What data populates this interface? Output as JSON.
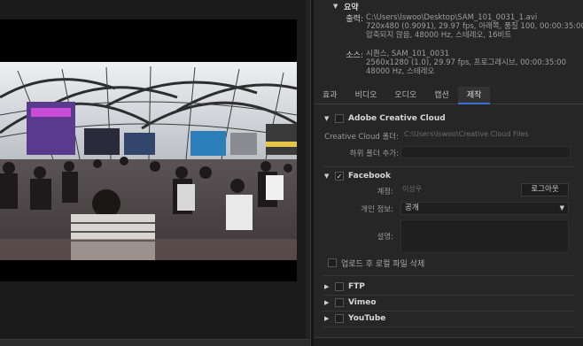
{
  "summary": {
    "title": "요약",
    "output_label": "출력:",
    "output_lines": [
      "C:\\Users\\lswoo\\Desktop\\SAM_101_0031_1.avi",
      "720x480 (0.9091), 29.97 fps, 아래쪽, 품질 100, 00:00:35:00",
      "압축되지 않음, 48000 Hz, 스테레오, 16비트"
    ],
    "source_label": "소스:",
    "source_lines": [
      "시퀀스, SAM_101_0031",
      "2560x1280 (1.0), 29.97 fps, 프로그레시브, 00:00:35:00",
      "48000 Hz, 스테레오"
    ]
  },
  "tabs": [
    {
      "label": "효과",
      "active": false
    },
    {
      "label": "비디오",
      "active": false
    },
    {
      "label": "오디오",
      "active": false
    },
    {
      "label": "캡션",
      "active": false
    },
    {
      "label": "제작",
      "active": true
    }
  ],
  "creative_cloud": {
    "title": "Adobe Creative Cloud",
    "folder_label": "Creative Cloud 폴더:",
    "folder_value": "C:\\Users\\lswoo\\Creative Cloud Files",
    "subfolder_label": "하위 폴더 추가:",
    "subfolder_value": ""
  },
  "facebook": {
    "title": "Facebook",
    "checked": true,
    "account_label": "계정:",
    "account_value": "이상우",
    "logout_label": "로그아웃",
    "privacy_label": "개인 정보:",
    "privacy_value": "공개",
    "description_label": "설명:",
    "description_value": "",
    "delete_label": "업로드 후 로컬 파일 삭제"
  },
  "other_sections": [
    {
      "title": "FTP"
    },
    {
      "title": "Vimeo"
    },
    {
      "title": "YouTube"
    }
  ],
  "colors": {
    "accent": "#3a71d8",
    "panel_bg": "#262626"
  }
}
